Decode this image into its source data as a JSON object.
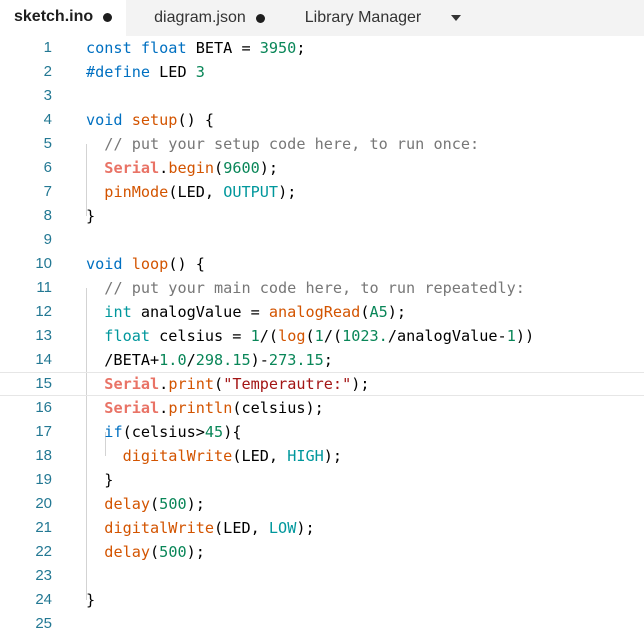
{
  "tabs": [
    {
      "label": "sketch.ino",
      "active": true,
      "modified": true
    },
    {
      "label": "diagram.json",
      "active": false,
      "modified": true
    },
    {
      "label": "Library Manager",
      "active": false,
      "modified": false
    }
  ],
  "editor": {
    "current_line": 15,
    "lines": [
      {
        "n": "1",
        "tokens": [
          [
            "kw2",
            "const"
          ],
          [
            "t",
            " "
          ],
          [
            "kw2",
            "float"
          ],
          [
            "t",
            " BETA = "
          ],
          [
            "num",
            "3950"
          ],
          [
            "t",
            ";"
          ]
        ]
      },
      {
        "n": "2",
        "tokens": [
          [
            "kw2",
            "#define"
          ],
          [
            "t",
            " LED "
          ],
          [
            "num",
            "3"
          ]
        ]
      },
      {
        "n": "3",
        "tokens": []
      },
      {
        "n": "4",
        "tokens": [
          [
            "kw2",
            "void"
          ],
          [
            "t",
            " "
          ],
          [
            "fn",
            "setup"
          ],
          [
            "t",
            "() {"
          ]
        ]
      },
      {
        "n": "5",
        "tokens": [
          [
            "t",
            "  "
          ],
          [
            "cm",
            "// put your setup code here, to run once:"
          ]
        ]
      },
      {
        "n": "6",
        "tokens": [
          [
            "t",
            "  "
          ],
          [
            "ser",
            "Serial"
          ],
          [
            "t",
            "."
          ],
          [
            "fn",
            "begin"
          ],
          [
            "t",
            "("
          ],
          [
            "num",
            "9600"
          ],
          [
            "t",
            ");"
          ]
        ]
      },
      {
        "n": "7",
        "tokens": [
          [
            "t",
            "  "
          ],
          [
            "fn",
            "pinMode"
          ],
          [
            "t",
            "(LED, "
          ],
          [
            "const",
            "OUTPUT"
          ],
          [
            "t",
            ");"
          ]
        ]
      },
      {
        "n": "8",
        "tokens": [
          [
            "t",
            "}"
          ]
        ]
      },
      {
        "n": "9",
        "tokens": []
      },
      {
        "n": "10",
        "tokens": [
          [
            "kw2",
            "void"
          ],
          [
            "t",
            " "
          ],
          [
            "fn",
            "loop"
          ],
          [
            "t",
            "() "
          ],
          [
            "t",
            "{"
          ]
        ]
      },
      {
        "n": "11",
        "tokens": [
          [
            "t",
            "  "
          ],
          [
            "cm",
            "// put your main code here, to run repeatedly:"
          ]
        ]
      },
      {
        "n": "12",
        "tokens": [
          [
            "t",
            "  "
          ],
          [
            "kw",
            "int"
          ],
          [
            "t",
            " analogValue = "
          ],
          [
            "fn",
            "analogRead"
          ],
          [
            "t",
            "("
          ],
          [
            "num",
            "A5"
          ],
          [
            "t",
            ");"
          ]
        ]
      },
      {
        "n": "13",
        "tokens": [
          [
            "t",
            "  "
          ],
          [
            "kw",
            "float"
          ],
          [
            "t",
            " celsius = "
          ],
          [
            "num",
            "1"
          ],
          [
            "t",
            "/("
          ],
          [
            "fn",
            "log"
          ],
          [
            "t",
            "("
          ],
          [
            "num",
            "1"
          ],
          [
            "t",
            "/("
          ],
          [
            "num",
            "1023."
          ],
          [
            "t",
            "/analogValue-"
          ],
          [
            "num",
            "1"
          ],
          [
            "t",
            "))"
          ]
        ]
      },
      {
        "n": "14",
        "tokens": [
          [
            "t",
            "  /BETA+"
          ],
          [
            "num",
            "1.0"
          ],
          [
            "t",
            "/"
          ],
          [
            "num",
            "298.15"
          ],
          [
            "t",
            ")-"
          ],
          [
            "num",
            "273.15"
          ],
          [
            "t",
            ";"
          ]
        ]
      },
      {
        "n": "15",
        "tokens": [
          [
            "t",
            "  "
          ],
          [
            "ser",
            "Serial"
          ],
          [
            "t",
            "."
          ],
          [
            "fn",
            "print"
          ],
          [
            "t",
            "("
          ],
          [
            "str",
            "\"Temperautre:\""
          ],
          [
            "t",
            ");"
          ]
        ]
      },
      {
        "n": "16",
        "tokens": [
          [
            "t",
            "  "
          ],
          [
            "ser",
            "Serial"
          ],
          [
            "t",
            "."
          ],
          [
            "fn",
            "println"
          ],
          [
            "t",
            "(celsius);"
          ]
        ]
      },
      {
        "n": "17",
        "tokens": [
          [
            "t",
            "  "
          ],
          [
            "kw2",
            "if"
          ],
          [
            "t",
            "(celsius>"
          ],
          [
            "num",
            "45"
          ],
          [
            "t",
            "){"
          ]
        ]
      },
      {
        "n": "18",
        "tokens": [
          [
            "t",
            "    "
          ],
          [
            "fn",
            "digitalWrite"
          ],
          [
            "t",
            "(LED, "
          ],
          [
            "const",
            "HIGH"
          ],
          [
            "t",
            ");"
          ]
        ]
      },
      {
        "n": "19",
        "tokens": [
          [
            "t",
            "  }"
          ]
        ]
      },
      {
        "n": "20",
        "tokens": [
          [
            "t",
            "  "
          ],
          [
            "fn",
            "delay"
          ],
          [
            "t",
            "("
          ],
          [
            "num",
            "500"
          ],
          [
            "t",
            ");"
          ]
        ]
      },
      {
        "n": "21",
        "tokens": [
          [
            "t",
            "  "
          ],
          [
            "fn",
            "digitalWrite"
          ],
          [
            "t",
            "(LED, "
          ],
          [
            "const",
            "LOW"
          ],
          [
            "t",
            ");"
          ]
        ]
      },
      {
        "n": "22",
        "tokens": [
          [
            "t",
            "  "
          ],
          [
            "fn",
            "delay"
          ],
          [
            "t",
            "("
          ],
          [
            "num",
            "500"
          ],
          [
            "t",
            ");"
          ]
        ]
      },
      {
        "n": "23",
        "tokens": []
      },
      {
        "n": "24",
        "tokens": [
          [
            "t",
            "}"
          ]
        ]
      },
      {
        "n": "25",
        "tokens": []
      }
    ]
  }
}
